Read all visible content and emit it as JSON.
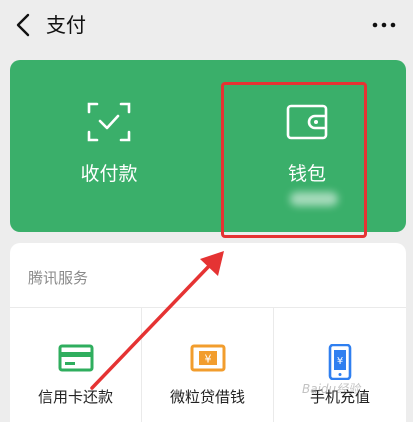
{
  "header": {
    "title": "支付"
  },
  "pay_card": {
    "receive_pay_label": "收付款",
    "wallet_label": "钱包"
  },
  "services": {
    "section_title": "腾讯服务",
    "items": [
      {
        "label": "信用卡还款",
        "icon": "credit-card-icon"
      },
      {
        "label": "微粒贷借钱",
        "icon": "loan-icon"
      },
      {
        "label": "手机充值",
        "icon": "phone-topup-icon"
      }
    ]
  },
  "annotation": {
    "watermark": "Baidu经验"
  },
  "colors": {
    "green": "#3aaf6a",
    "annotation_red": "#e53333",
    "card_green_icon": "#2fae5e",
    "loan_orange": "#f29d2d",
    "phone_blue": "#2f7ff0"
  }
}
